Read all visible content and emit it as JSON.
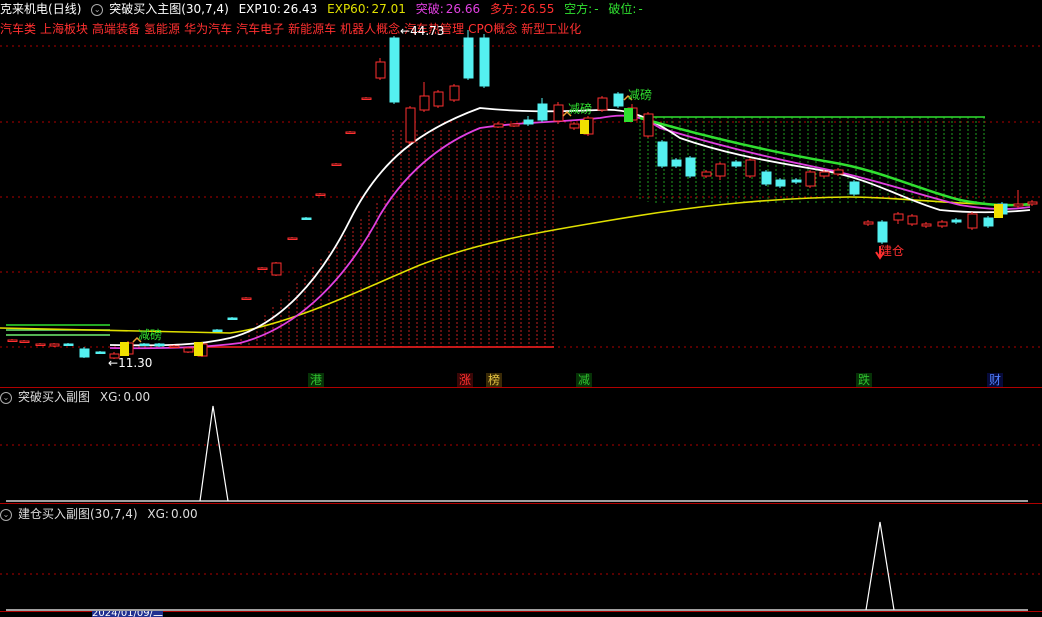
{
  "header": {
    "stock_name": "克来机电",
    "period": "(日线)",
    "indicator": "突破买入主图(30,7,4)",
    "exp10_label": "EXP10:",
    "exp10_value": "26.43",
    "exp60_label": "EXP60:",
    "exp60_value": "27.01",
    "tupo_label": "突破:",
    "tupo_value": "26.66",
    "duofang_label": "多方:",
    "duofang_value": "26.55",
    "kongfang_label": "空方:",
    "kongfang_value": "-",
    "powei_label": "破位:",
    "powei_value": "-"
  },
  "concept_tags": [
    "汽车类",
    "上海板块",
    "高端装备",
    "氢能源",
    "华为汽车",
    "汽车电子",
    "新能源车",
    "机器人概念",
    "汽车热管理",
    "CPO概念",
    "新型工业化"
  ],
  "price_labels": {
    "high": "44.73",
    "low": "11.30",
    "high_arrow": "←",
    "low_arrow": "←"
  },
  "chart_annotations": {
    "reduce1": "减磅",
    "reduce2": "减磅",
    "reduce3": "减磅",
    "build": "建仓"
  },
  "event_tags": [
    {
      "text": "港",
      "color": "#30c030"
    },
    {
      "text": "涨",
      "color": "#ff3030"
    },
    {
      "text": "榜",
      "color": "#e0c040"
    },
    {
      "text": "减",
      "color": "#30c030"
    },
    {
      "text": "跌",
      "color": "#30c030"
    },
    {
      "text": "财",
      "color": "#5080ff"
    }
  ],
  "sub1": {
    "title": "突破买入副图",
    "xg_label": "XG:",
    "xg_value": "0.00"
  },
  "sub2": {
    "title": "建仓买入副图(30,7,4)",
    "xg_label": "XG:",
    "xg_value": "0.00"
  },
  "footer": {
    "date": "2024/01/09/二"
  },
  "colors": {
    "up": "#ff3030",
    "down": "#54f0f0",
    "exp10": "#ffffff",
    "exp60": "#e0e000",
    "tupo": "#e040e0",
    "duofang_band": "#30e030",
    "grid": "#b00000"
  }
}
